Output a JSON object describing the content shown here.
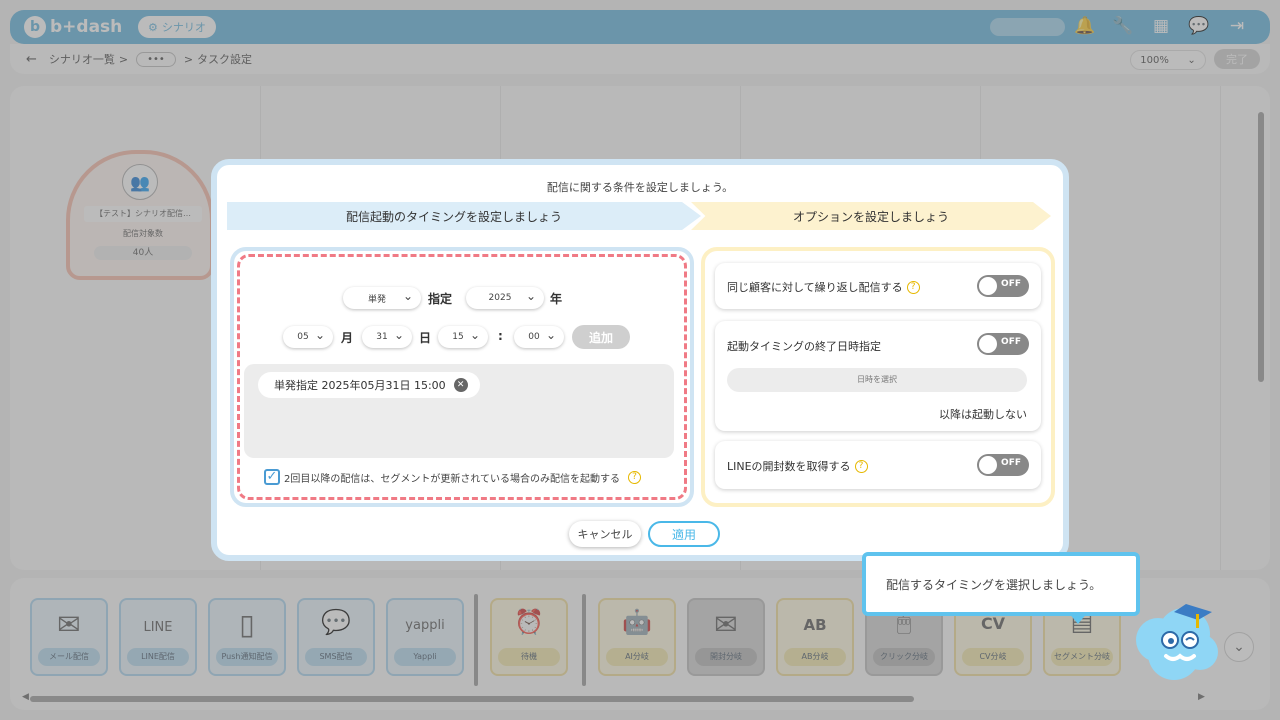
{
  "header": {
    "logo_text": "b+dash",
    "logo_mark": "b",
    "scenario_label": "シナリオ",
    "icons": [
      "bell-icon",
      "wrench-icon",
      "grid-icon",
      "chat-icon",
      "logout-icon"
    ]
  },
  "nav": {
    "back": "←",
    "crumb_list": "シナリオ一覧",
    "sep": ">",
    "more": "•••",
    "crumb_current": "タスク設定",
    "zoom": "100%",
    "zoom_caret": "⌄",
    "done": "完了"
  },
  "node": {
    "title": "【テスト】シナリオ配信…",
    "count_label": "配信対象数",
    "count": "40人"
  },
  "modal": {
    "title": "配信に関する条件を設定しましょう。",
    "step1": "配信起動のタイミングを設定しましょう",
    "step2": "オプションを設定しましょう",
    "type_select": "単発",
    "type_unit": "指定",
    "year_select": "2025",
    "year_unit": "年",
    "month_select": "05",
    "month_unit": "月",
    "day_select": "31",
    "day_unit": "日",
    "hour_select": "15",
    "colon": ":",
    "minute_select": "00",
    "add_button": "追加",
    "chip_text": "単発指定 2025年05月31日 15:00",
    "chip_remove": "✕",
    "checkbox_mark": "✓",
    "checkbox_label": "2回目以降の配信は、セグメントが更新されている場合のみ配信を起動する",
    "help": "?",
    "options": {
      "repeat_label": "同じ顧客に対して繰り返し配信する",
      "repeat_state": "OFF",
      "end_label": "起動タイミングの終了日時指定",
      "end_state": "OFF",
      "date_button": "日時を選択",
      "no_start": "以降は起動しない",
      "line_label": "LINEの開封数を取得する",
      "line_state": "OFF"
    },
    "cancel": "キャンセル",
    "apply": "適用"
  },
  "tooltip": {
    "text": "配信するタイミングを選択しましょう。"
  },
  "palette": {
    "tools": [
      {
        "label": "メール配信",
        "icon": "✉",
        "icon_name": "mail-icon"
      },
      {
        "label": "LINE配信",
        "icon": "LINE",
        "icon_name": "line-icon"
      },
      {
        "label": "Push通知配信",
        "icon": "▯",
        "icon_name": "push-icon"
      },
      {
        "label": "SMS配信",
        "icon": "💬",
        "icon_name": "sms-icon"
      },
      {
        "label": "Yappli",
        "icon": "yappli",
        "icon_name": "yappli-icon"
      },
      {
        "label": "待機",
        "icon": "⏰",
        "icon_name": "alarm-icon"
      },
      {
        "label": "AI分岐",
        "icon": "🤖",
        "icon_name": "robot-icon"
      },
      {
        "label": "開封分岐",
        "icon": "✉",
        "icon_name": "open-mail-icon"
      },
      {
        "label": "AB分岐",
        "icon": "AB",
        "icon_name": "ab-icon"
      },
      {
        "label": "クリック分岐",
        "icon": "🖱",
        "icon_name": "mouse-icon"
      },
      {
        "label": "CV分岐",
        "icon": "CV",
        "icon_name": "cv-icon"
      },
      {
        "label": "セグメント分岐",
        "icon": "▤",
        "icon_name": "segment-icon"
      }
    ],
    "scroll_left": "◀",
    "scroll_right": "▶",
    "expand": "⌄"
  }
}
